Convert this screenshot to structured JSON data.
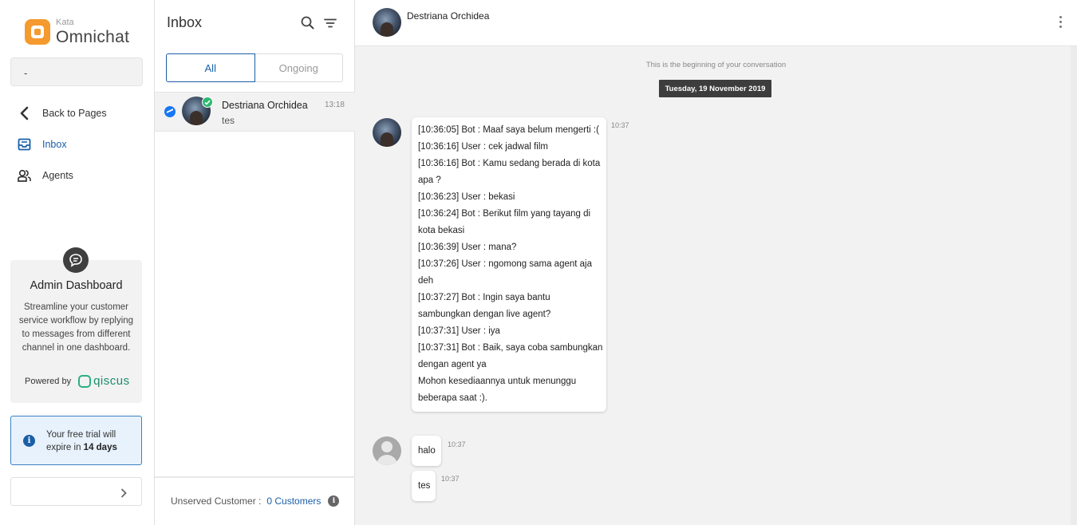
{
  "brand": {
    "small": "Kata",
    "big": "Omnichat"
  },
  "page_select": {
    "value": "-"
  },
  "nav": [
    {
      "label": "Back to Pages",
      "icon": "back-arrow-icon"
    },
    {
      "label": "Inbox",
      "icon": "inbox-icon"
    },
    {
      "label": "Agents",
      "icon": "agents-icon"
    }
  ],
  "dashboard_card": {
    "title": "Admin Dashboard",
    "description": "Streamline your customer service workflow by replying to messages from different channel in one dashboard.",
    "powered_by": "Powered by",
    "powered_brand": "qiscus"
  },
  "trial": {
    "text_prefix": "Your free trial will expire in",
    "days": "14 days"
  },
  "inbox": {
    "title": "Inbox",
    "tabs": [
      {
        "label": "All"
      },
      {
        "label": "Ongoing"
      }
    ],
    "conversations": [
      {
        "name": "Destriana Orchidea",
        "time": "13:18",
        "preview": "tes",
        "channel": "messenger"
      }
    ],
    "footer": {
      "label": "Unserved Customer :",
      "count": "0 Customers"
    }
  },
  "chat": {
    "contact_name": "Destriana Orchidea",
    "beginning_text": "This is the beginning of your conversation",
    "date": "Tuesday, 19 November 2019",
    "messages": [
      {
        "time": "10:37",
        "lines": [
          "[10:36:05] Bot : Maaf saya belum mengerti :(",
          "[10:36:16] User : cek jadwal film",
          "[10:36:16] Bot : Kamu sedang berada di kota",
          "apa ?",
          "[10:36:23] User : bekasi",
          "[10:36:24] Bot : Berikut film yang tayang di",
          "kota bekasi",
          "[10:36:39] User : mana?",
          "[10:37:26] User : ngomong sama agent aja",
          "deh",
          "[10:37:27] Bot : Ingin saya bantu",
          "sambungkan dengan live agent?",
          "[10:37:31] User : iya",
          "[10:37:31] Bot : Baik, saya coba sambungkan",
          "dengan agent ya",
          "Mohon kesediaannya untuk menunggu",
          "beberapa saat :)."
        ]
      },
      {
        "time": "10:37",
        "lines": [
          "halo"
        ]
      },
      {
        "time": "10:37",
        "lines": [
          "tes"
        ]
      }
    ]
  },
  "colors": {
    "accent": "#1a5fa8",
    "brand_orange": "#f59a2e",
    "online_green": "#2eb872",
    "messenger_blue": "#1877f2"
  }
}
